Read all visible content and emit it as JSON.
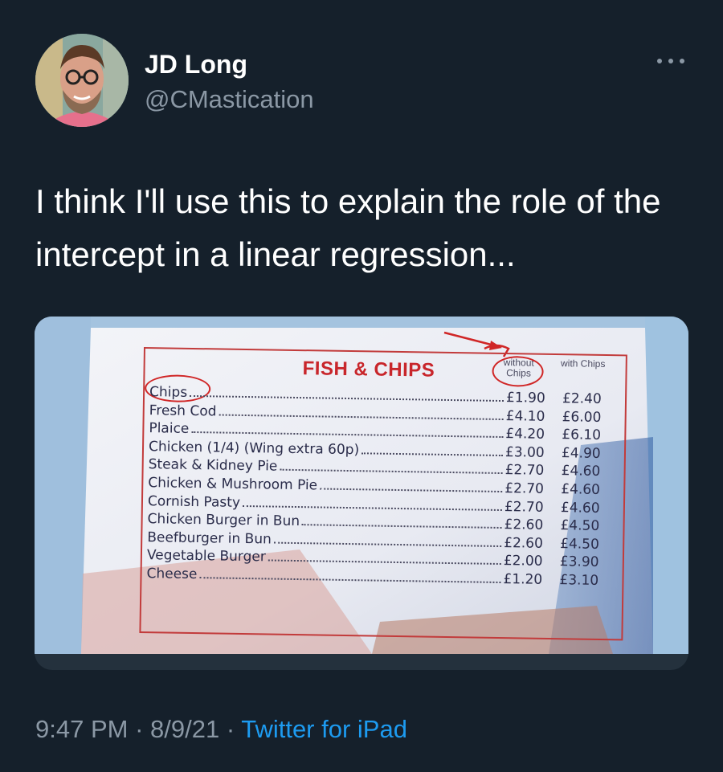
{
  "tweet": {
    "name": "JD Long",
    "handle": "@CMastication",
    "text": "I think I'll use this to explain the role of the intercept in a linear regression...",
    "time": "9:47 PM",
    "separator1": " · ",
    "date": "8/9/21",
    "separator2": " · ",
    "source": "Twitter for iPad"
  },
  "menu": {
    "title": "FISH & CHIPS",
    "col_without": "without Chips",
    "col_with": "with Chips",
    "items": [
      {
        "name": "Chips",
        "without": "£1.90",
        "with": "£2.40"
      },
      {
        "name": "Fresh Cod",
        "without": "£4.10",
        "with": "£6.00"
      },
      {
        "name": "Plaice",
        "without": "£4.20",
        "with": "£6.10"
      },
      {
        "name": "Chicken (1/4) (Wing extra 60p)",
        "without": "£3.00",
        "with": "£4.90"
      },
      {
        "name": "Steak & Kidney Pie",
        "without": "£2.70",
        "with": "£4.60"
      },
      {
        "name": "Chicken & Mushroom Pie",
        "without": "£2.70",
        "with": "£4.60"
      },
      {
        "name": "Cornish Pasty",
        "without": "£2.70",
        "with": "£4.60"
      },
      {
        "name": "Chicken Burger in Bun",
        "without": "£2.60",
        "with": "£4.50"
      },
      {
        "name": "Beefburger in Bun",
        "without": "£2.60",
        "with": "£4.50"
      },
      {
        "name": "Vegetable Burger",
        "without": "£2.00",
        "with": "£3.90"
      },
      {
        "name": "Cheese",
        "without": "£1.20",
        "with": "£3.10"
      }
    ]
  },
  "icons": {
    "more": "more-horizontal-icon",
    "arrow": "red-arrow-annotation"
  },
  "colors": {
    "background": "#15202b",
    "secondary_text": "#8b98a5",
    "link": "#1d9bf0",
    "menu_red": "#c8262b"
  }
}
